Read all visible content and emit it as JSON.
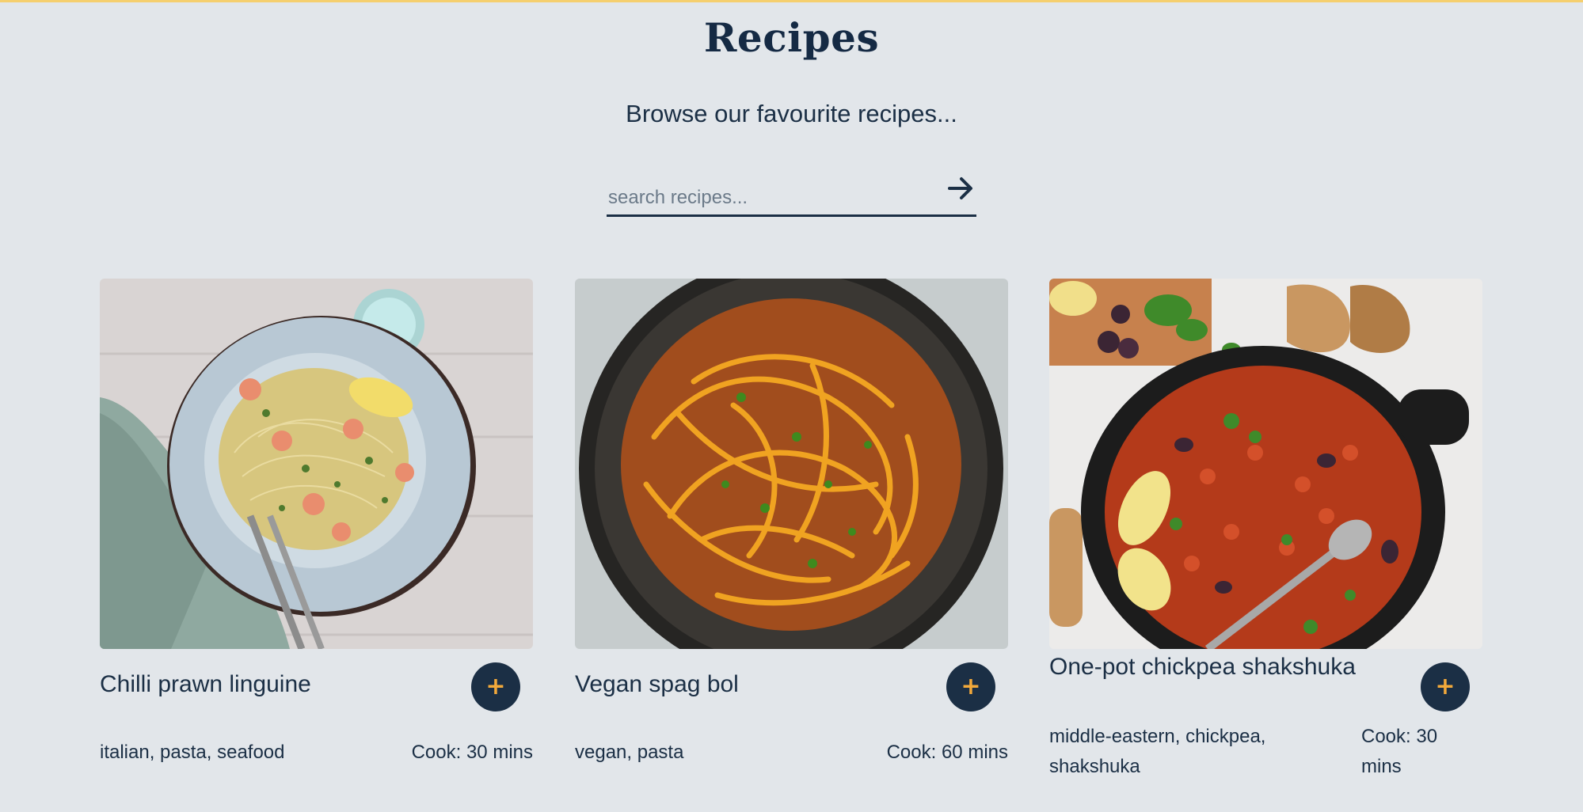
{
  "header": {
    "title": "Recipes",
    "subtitle": "Browse our favourite recipes..."
  },
  "search": {
    "placeholder": "search recipes...",
    "value": "",
    "button_icon": "arrow-right-icon"
  },
  "recipes": [
    {
      "title": "Chilli prawn linguine",
      "tags": "italian, pasta, seafood",
      "cook": "Cook: 30 mins",
      "add_icon": "+"
    },
    {
      "title": "Vegan spag bol",
      "tags": "vegan, pasta",
      "cook": "Cook: 60 mins",
      "add_icon": "+"
    },
    {
      "title": "One-pot chickpea shakshuka",
      "tags": "middle-eastern, chickpea, shakshuka",
      "cook": "Cook: 30 mins",
      "add_icon": "+"
    }
  ],
  "colors": {
    "background": "#e2e6ea",
    "navy": "#1b2f45",
    "accent": "#f2a93b",
    "top_strip": "#f5cf6e"
  }
}
